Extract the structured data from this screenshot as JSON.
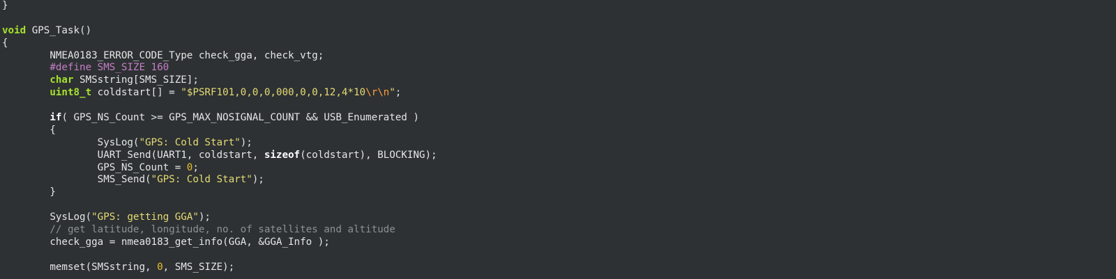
{
  "editor": {
    "lines": [
      [
        {
          "t": "}",
          "c": "id"
        }
      ],
      [],
      [
        {
          "t": "void",
          "c": "kw"
        },
        {
          "t": " GPS_Task()",
          "c": "id"
        }
      ],
      [
        {
          "t": "{",
          "c": "id"
        }
      ],
      [
        {
          "t": "        NMEA0183_ERROR_CODE_Type check_gga, check_vtg;",
          "c": "id"
        }
      ],
      [
        {
          "t": "        ",
          "c": "id"
        },
        {
          "t": "#define SMS_SIZE 160",
          "c": "pp"
        }
      ],
      [
        {
          "t": "        ",
          "c": "id"
        },
        {
          "t": "char",
          "c": "kw"
        },
        {
          "t": " SMSstring[SMS_SIZE];",
          "c": "id"
        }
      ],
      [
        {
          "t": "        ",
          "c": "id"
        },
        {
          "t": "uint8_t",
          "c": "kw"
        },
        {
          "t": " coldstart[] = ",
          "c": "id"
        },
        {
          "t": "\"$PSRF101,0,0,0,000,0,0,12,4*10",
          "c": "str"
        },
        {
          "t": "\\r\\n",
          "c": "esc"
        },
        {
          "t": "\"",
          "c": "str"
        },
        {
          "t": ";",
          "c": "id"
        }
      ],
      [],
      [
        {
          "t": "        ",
          "c": "id"
        },
        {
          "t": "if",
          "c": "kw2"
        },
        {
          "t": "( GPS_NS_Count >= GPS_MAX_NOSIGNAL_COUNT && USB_Enumerated )",
          "c": "id"
        }
      ],
      [
        {
          "t": "        {",
          "c": "id"
        }
      ],
      [
        {
          "t": "                SysLog(",
          "c": "id"
        },
        {
          "t": "\"GPS: Cold Start\"",
          "c": "str"
        },
        {
          "t": ");",
          "c": "id"
        }
      ],
      [
        {
          "t": "                UART_Send(UART1, coldstart, ",
          "c": "id"
        },
        {
          "t": "sizeof",
          "c": "kw2"
        },
        {
          "t": "(coldstart), BLOCKING);",
          "c": "id"
        }
      ],
      [
        {
          "t": "                GPS_NS_Count = ",
          "c": "id"
        },
        {
          "t": "0",
          "c": "num"
        },
        {
          "t": ";",
          "c": "id"
        }
      ],
      [
        {
          "t": "                SMS_Send(",
          "c": "id"
        },
        {
          "t": "\"GPS: Cold Start\"",
          "c": "str"
        },
        {
          "t": ");",
          "c": "id"
        }
      ],
      [
        {
          "t": "        }",
          "c": "id"
        }
      ],
      [],
      [
        {
          "t": "        SysLog(",
          "c": "id"
        },
        {
          "t": "\"GPS: getting GGA\"",
          "c": "str"
        },
        {
          "t": ");",
          "c": "id"
        }
      ],
      [
        {
          "t": "        // get latitude, longitude, no. of satellites and altitude",
          "c": "cmt"
        }
      ],
      [
        {
          "t": "        check_gga = nmea0183_get_info(GGA, &GGA_Info );",
          "c": "id"
        }
      ],
      [],
      [
        {
          "t": "        memset(SMSstring, ",
          "c": "id"
        },
        {
          "t": "0",
          "c": "num"
        },
        {
          "t": ", SMS_SIZE);",
          "c": "id"
        }
      ]
    ]
  }
}
